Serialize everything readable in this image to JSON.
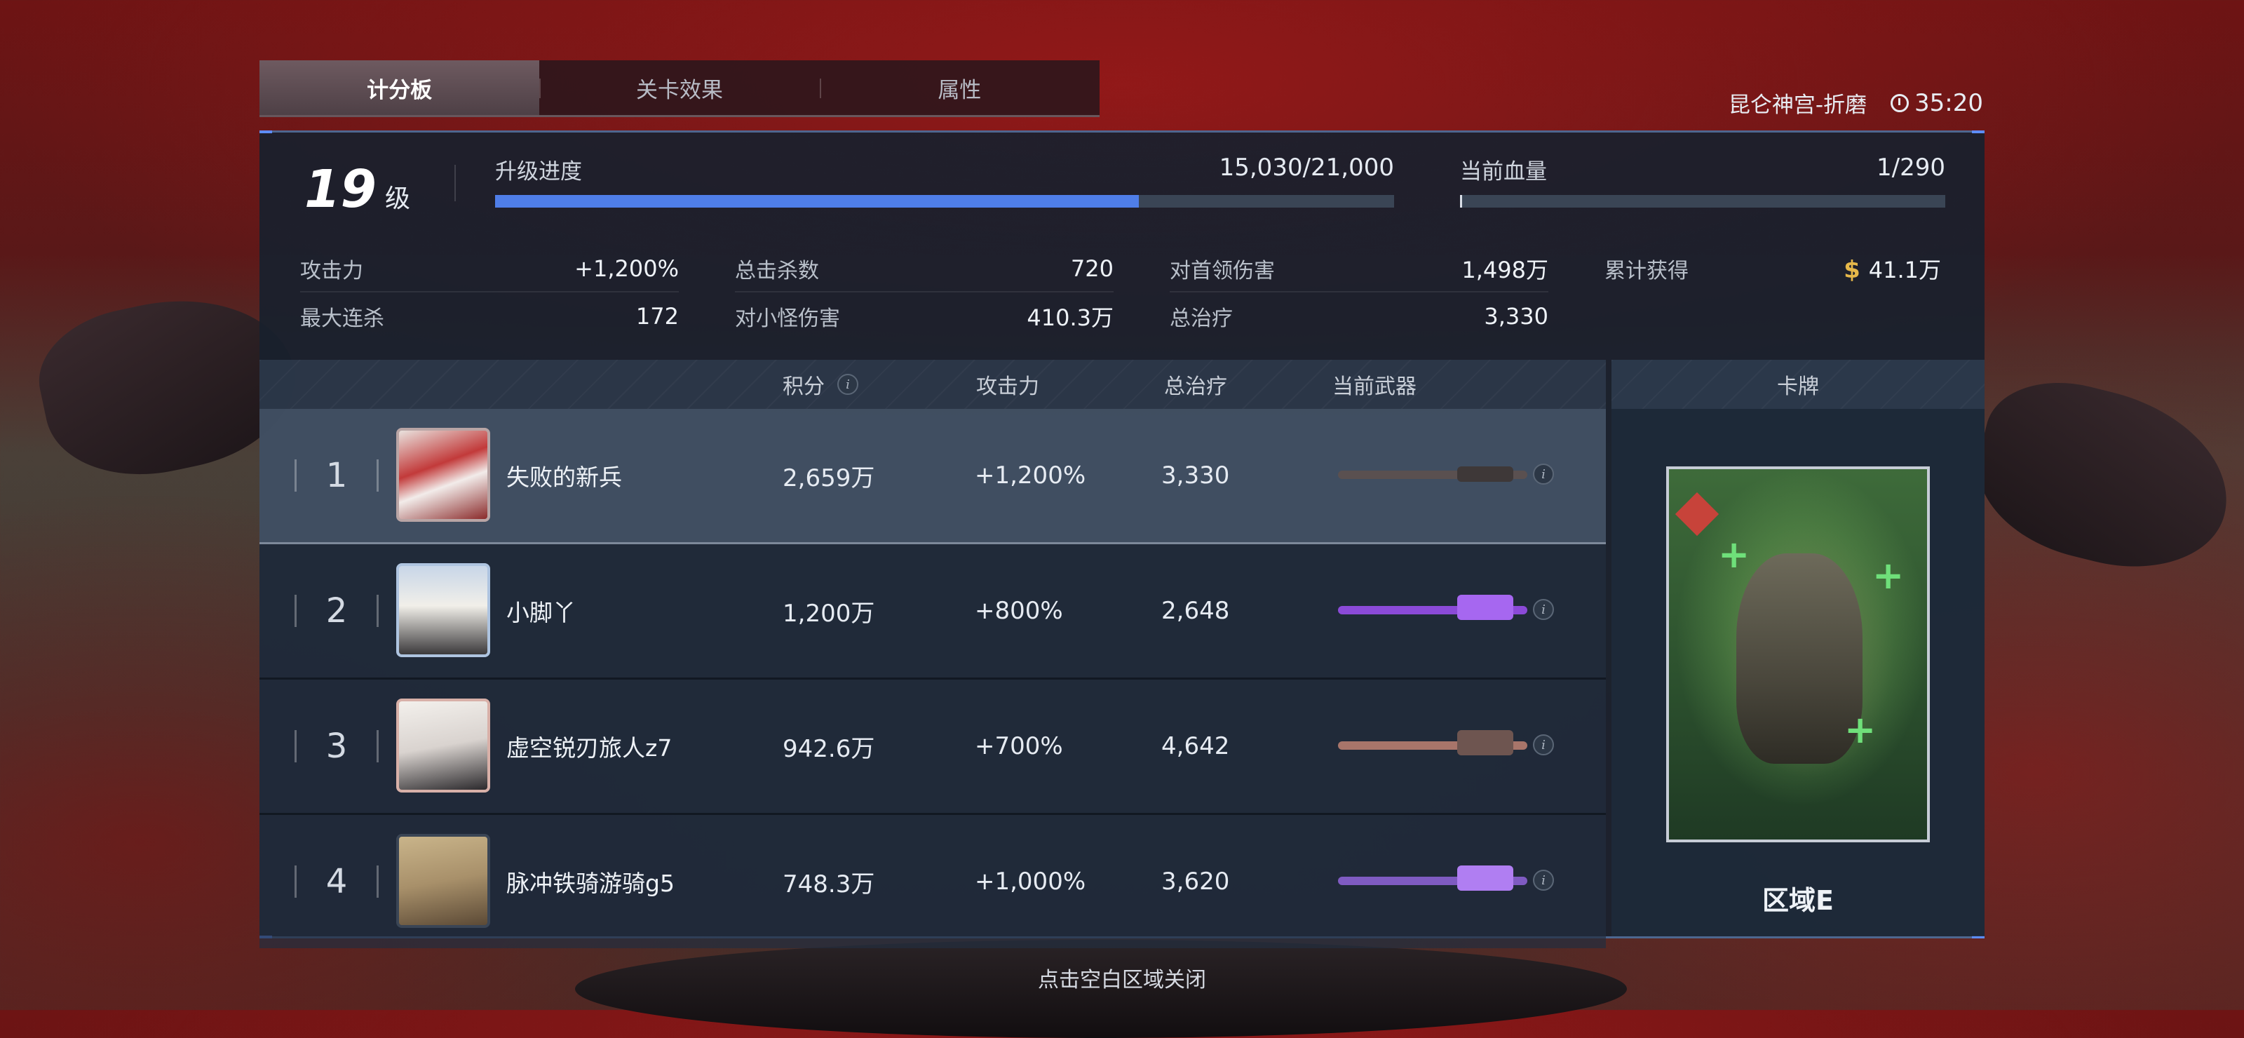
{
  "tabs": [
    {
      "label": "计分板",
      "active": true
    },
    {
      "label": "关卡效果",
      "active": false
    },
    {
      "label": "属性",
      "active": false
    }
  ],
  "location": "昆仑神宫-折磨",
  "timer": "35:20",
  "level": {
    "number": "19",
    "unit": "级"
  },
  "upgrade": {
    "label": "升级进度",
    "value": "15,030/21,000",
    "progress": 0.716
  },
  "health": {
    "label": "当前血量",
    "value": "1/290",
    "progress": 0.0034
  },
  "stats": {
    "attack": {
      "label": "攻击力",
      "value": "+1,200%"
    },
    "total_kills": {
      "label": "总击杀数",
      "value": "720"
    },
    "boss_damage": {
      "label": "对首领伤害",
      "value": "1,498万"
    },
    "earned": {
      "label": "累计获得",
      "value": "41.1万"
    },
    "max_combo": {
      "label": "最大连杀",
      "value": "172"
    },
    "minion_damage": {
      "label": "对小怪伤害",
      "value": "410.3万"
    },
    "total_heal": {
      "label": "总治疗",
      "value": "3,330"
    }
  },
  "currency_symbol": "$",
  "table": {
    "headers": {
      "score": "积分",
      "attack": "攻击力",
      "heal": "总治疗",
      "weapon": "当前武器"
    },
    "rows": [
      {
        "rank": "1",
        "name": "失败的新兵",
        "score": "2,659万",
        "attack": "+1,200%",
        "heal": "3,330",
        "weapon_color": "#5a5050"
      },
      {
        "rank": "2",
        "name": "小脚丫",
        "score": "1,200万",
        "attack": "+800%",
        "heal": "2,648",
        "weapon_color": "#8b4ad8"
      },
      {
        "rank": "3",
        "name": "虚空锐刃旅人z7",
        "score": "942.6万",
        "attack": "+700%",
        "heal": "4,642",
        "weapon_color": "#a8756a"
      },
      {
        "rank": "4",
        "name": "脉冲铁骑游骑g5",
        "score": "748.3万",
        "attack": "+1,000%",
        "heal": "3,620",
        "weapon_color": "#7f5bc2"
      }
    ]
  },
  "card": {
    "header": "卡牌",
    "label": "区域E"
  },
  "footer_hint": "点击空白区域关闭",
  "colors": {
    "accent": "#4f7ee8",
    "gold": "#e6b84a",
    "panel": "#18212e"
  }
}
